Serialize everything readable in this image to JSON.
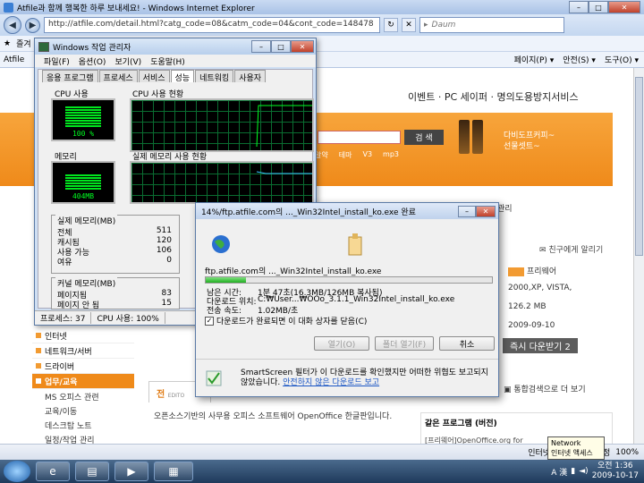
{
  "browser": {
    "title": "Atfile과 함께 행복한 하루 보내세요! - Windows Internet Explorer",
    "url": "http://atfile.com/detail.html?catg_code=08&catm_code=04&cont_code=148478",
    "search_placeholder": "Daum",
    "fav_label": "즐겨",
    "tab_label": "Atfile",
    "cmd_page": "페이지(P) ▾",
    "cmd_safety": "안전(S) ▾",
    "cmd_tools": "도구(O) ▾",
    "status_zone": "인터넷 | 보호 모드: 설정",
    "zoom": "100%"
  },
  "site": {
    "topnav": "이벤트 · PC 세이퍼 · 명의도용방지서비스",
    "search_btn": "검 색",
    "categories": [
      "알약",
      "테마",
      "V3",
      "mp3"
    ],
    "ad_text": "다비도프커피~",
    "ad_sub": "선물셋트~",
    "breadcrumb": "관리",
    "report": "친구에게 알리기",
    "spec": {
      "type": "프리웨어",
      "os": "2000,XP, VISTA,",
      "size": "126.2 MB",
      "date": "2009-09-10"
    },
    "download_now": "즉시 다운받기 2",
    "menu": {
      "items": [
        "인터넷",
        "네트워크/서버",
        "드라이버",
        "업무/교육"
      ],
      "subs": [
        "MS 오피스 관련",
        "교육/이동",
        "데스크탑 노트",
        "일정/작업 관리"
      ]
    },
    "box_tab": "전",
    "box_tab_sub": "EDITO",
    "description": "오픈소스기반의 사무용 오피스 소프트웨어 OpenOffice 한글판입니다.",
    "tagline": "통합검색으로 더 보기",
    "related_title": "같은 프로그램 (버전)",
    "related_row": "[프리웨어]OpenOffice.org for"
  },
  "taskmgr": {
    "title": "Windows 작업 관리자",
    "menu": [
      "파일(F)",
      "옵션(O)",
      "보기(V)",
      "도움말(H)"
    ],
    "tabs": [
      "응용 프로그램",
      "프로세스",
      "서비스",
      "성능",
      "네트워킹",
      "사용자"
    ],
    "cpu_label": "CPU 사용",
    "cpu_value": "100 %",
    "cpu_hist_label": "CPU 사용 현황",
    "mem_label": "메모리",
    "mem_value": "404MB",
    "mem_hist_label": "실제 메모리 사용 현황",
    "phys_title": "실제 메모리(MB)",
    "phys": [
      {
        "k": "전체",
        "v": "511"
      },
      {
        "k": "캐시됨",
        "v": "120"
      },
      {
        "k": "사용 가능",
        "v": "106"
      },
      {
        "k": "여유",
        "v": "0"
      }
    ],
    "kernel_title": "커널 메모리(MB)",
    "kernel": [
      {
        "k": "페이지됨",
        "v": "83"
      },
      {
        "k": "페이지 안 됨",
        "v": "15"
      }
    ],
    "status_procs": "프로세스: 37",
    "status_cpu": "CPU 사용: 100%",
    "cpu_level": 1.0,
    "mem_level": 0.79
  },
  "download": {
    "title": "14%/ftp.atfile.com의 ..._Win32Intel_install_ko.exe  완료",
    "filename": "ftp.atfile.com의 ..._Win32Intel_install_ko.exe",
    "progress": 0.14,
    "rows": [
      {
        "k": "남은 시간:",
        "v": "1분 47초(16.3MB/126MB 복사됨)"
      },
      {
        "k": "다운로드 위치:",
        "v": "C:₩User...₩OOo_3.1.1_Win32Intel_install_ko.exe"
      },
      {
        "k": "전송 속도:",
        "v": "1.02MB/초"
      }
    ],
    "close_when_done": "다운로드가 완료되면 이 대화 상자를 닫음(C)",
    "btn_open": "열기(O)",
    "btn_folder": "폴더 열기(F)",
    "btn_cancel": "취소",
    "smartscreen_text": "SmartScreen 필터가 이 다운로드를 확인했지만 어떠한 위협도 보고되지 않았습니다.",
    "smartscreen_link": "안전하지 않은 다운로드 보고"
  },
  "taskbar": {
    "lang": "A 漢",
    "time": "오전 1:36",
    "date": "2009-10-17",
    "net_popup_1": "Network",
    "net_popup_2": "인터넷 액세스"
  }
}
